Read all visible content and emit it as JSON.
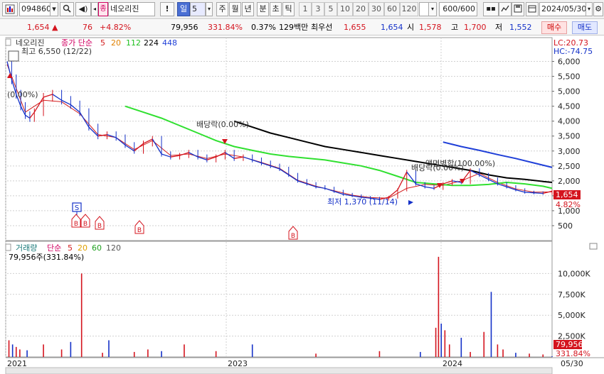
{
  "toolbar": {
    "code": "094860",
    "name": "네오리진",
    "name_badge": "종",
    "period_sel": "일",
    "period_num": "5",
    "periods": [
      "주",
      "월",
      "년",
      "분",
      "초",
      "틱"
    ],
    "intervals": [
      "1",
      "3",
      "5",
      "10",
      "20",
      "30",
      "60",
      "120"
    ],
    "count": "600",
    "count_total": "/600",
    "date": "2024/05/30"
  },
  "quote": {
    "price": "1,654",
    "change": "76",
    "change_pct": "+4.82%",
    "volume": "79,956",
    "volume_ratio": "331.84%",
    "turnover": "0.37%",
    "amount": "129백만",
    "best_label": "최우선",
    "ask": "1,655",
    "bid": "1,654",
    "open_label": "시",
    "open": "1,578",
    "high_label": "고",
    "high": "1,700",
    "low_label": "저",
    "low": "1,552",
    "buy_label": "매수",
    "sell_label": "매도"
  },
  "colors": {
    "up": "#d4141e",
    "down": "#1431c8",
    "ma5": "#d42020",
    "ma20": "#e08000",
    "ma112": "#30e030",
    "ma224": "#000000",
    "ma448": "#1f3fd8"
  },
  "chart_data": [
    {
      "type": "line",
      "ytick_labels": [
        "6,000",
        "5,500",
        "5,000",
        "4,500",
        "4,000",
        "3,500",
        "3,000",
        "2,500",
        "2,000",
        "1,500",
        "1,000",
        "500"
      ],
      "ylim": [
        0,
        6750
      ],
      "xlim": [
        0,
        600
      ],
      "xtick_labels": [
        "2021",
        "2023",
        "2024",
        "05/30"
      ],
      "legend": {
        "stock": "네오리진",
        "mode": "종가 단순",
        "periods": [
          "5",
          "20",
          "112",
          "224",
          "448"
        ]
      },
      "y_marker_top": "LC:20.73",
      "y_marker_top2": "HC:-74.75",
      "last_price": "1,654",
      "last_pct": "4.82%",
      "annotations": {
        "high": "최고 6,550 (12/22)",
        "low": "최저 1,370 (11/14)",
        "ex_div1": "배당락(0.00%)",
        "ex_div2": "배당락(0.00%)",
        "ex_div3": "액면병합(100.00%)",
        "left_pct": "(0.00%)"
      },
      "markers": [
        "S",
        "B",
        "B",
        "B",
        "B",
        "B"
      ],
      "series": [
        {
          "name": "close",
          "x": [
            0,
            5,
            10,
            15,
            20,
            25,
            30,
            40,
            50,
            60,
            70,
            80,
            90,
            100,
            110,
            120,
            130,
            140,
            150,
            160,
            170,
            180,
            190,
            200,
            210,
            220,
            230,
            240,
            250,
            260,
            270,
            280,
            290,
            300,
            310,
            320,
            330,
            340,
            350,
            360,
            370,
            380,
            390,
            400,
            410,
            420,
            430,
            440,
            450,
            460,
            470,
            480,
            490,
            500,
            510,
            520,
            530,
            540,
            550,
            560,
            570,
            580,
            590,
            600
          ],
          "y": [
            6000,
            5400,
            4900,
            4500,
            4200,
            4100,
            4300,
            4800,
            4900,
            4700,
            4550,
            4300,
            3800,
            3500,
            3550,
            3450,
            3200,
            3000,
            3250,
            3400,
            2900,
            2800,
            2850,
            2950,
            2800,
            2700,
            2800,
            2950,
            2750,
            2800,
            2700,
            2600,
            2500,
            2400,
            2200,
            2000,
            1900,
            1800,
            1750,
            1650,
            1550,
            1500,
            1450,
            1420,
            1380,
            1450,
            1700,
            2300,
            1900,
            1800,
            1750,
            1900,
            2000,
            1950,
            2350,
            2200,
            2050,
            1900,
            1800,
            1700,
            1620,
            1600,
            1580,
            1654
          ]
        },
        {
          "name": "5",
          "x": [
            0,
            20,
            40,
            60,
            80,
            100,
            120,
            140,
            160,
            180,
            200,
            220,
            240,
            260,
            280,
            300,
            320,
            340,
            360,
            380,
            400,
            420,
            440,
            460,
            480,
            500,
            520,
            540,
            560,
            580,
            600
          ],
          "y": [
            5900,
            4300,
            4700,
            4650,
            4250,
            3550,
            3450,
            3050,
            3350,
            2850,
            2900,
            2750,
            2900,
            2800,
            2620,
            2420,
            2020,
            1820,
            1670,
            1520,
            1440,
            1420,
            1750,
            1880,
            1850,
            2000,
            2250,
            1950,
            1730,
            1620,
            1630
          ]
        },
        {
          "name": "112",
          "x": [
            130,
            150,
            170,
            190,
            210,
            230,
            250,
            270,
            290,
            310,
            330,
            350,
            370,
            390,
            410,
            430,
            450,
            470,
            490,
            510,
            530,
            550,
            570,
            590,
            600
          ],
          "y": [
            4500,
            4300,
            4100,
            3850,
            3600,
            3350,
            3150,
            3020,
            2900,
            2820,
            2760,
            2700,
            2600,
            2500,
            2350,
            2150,
            1950,
            1900,
            1850,
            1850,
            1880,
            1950,
            1900,
            1820,
            1750
          ]
        },
        {
          "name": "224",
          "x": [
            250,
            270,
            290,
            310,
            330,
            350,
            370,
            390,
            410,
            430,
            450,
            470,
            490,
            510,
            530,
            550,
            570,
            590,
            600
          ],
          "y": [
            4000,
            3800,
            3600,
            3450,
            3300,
            3150,
            3050,
            2950,
            2850,
            2750,
            2650,
            2550,
            2450,
            2350,
            2200,
            2100,
            2050,
            1980,
            1950
          ]
        },
        {
          "name": "448",
          "x": [
            480,
            500,
            520,
            540,
            560,
            580,
            600
          ],
          "y": [
            3300,
            3150,
            3020,
            2880,
            2750,
            2600,
            2450
          ]
        }
      ]
    },
    {
      "type": "bar",
      "legend": {
        "label": "거래량",
        "mode": "단순",
        "periods": [
          "5",
          "20",
          "60",
          "120"
        ]
      },
      "info": "79,956주(331.84%)",
      "ytick_labels": [
        "10,000K",
        "7,500K",
        "5,000K",
        "2,500K"
      ],
      "ylim": [
        0,
        12500000
      ],
      "xlim": [
        0,
        600
      ],
      "last_volume": "79,956",
      "last_pct": "331.84%",
      "series": [
        {
          "name": "volume",
          "x": [
            2,
            6,
            10,
            14,
            22,
            40,
            60,
            70,
            82,
            105,
            112,
            140,
            155,
            170,
            195,
            230,
            270,
            340,
            410,
            455,
            472,
            475,
            478,
            482,
            487,
            500,
            510,
            525,
            533,
            540,
            546,
            560,
            575,
            590,
            600
          ],
          "y": [
            2000000,
            1500000,
            1200000,
            900000,
            800000,
            1500000,
            900000,
            1800000,
            10000000,
            500000,
            2000000,
            600000,
            900000,
            700000,
            1500000,
            700000,
            1500000,
            400000,
            700000,
            600000,
            3500000,
            12000000,
            4000000,
            3200000,
            1500000,
            2300000,
            600000,
            3000000,
            7800000,
            1500000,
            900000,
            500000,
            400000,
            300000,
            79956
          ]
        }
      ]
    }
  ]
}
